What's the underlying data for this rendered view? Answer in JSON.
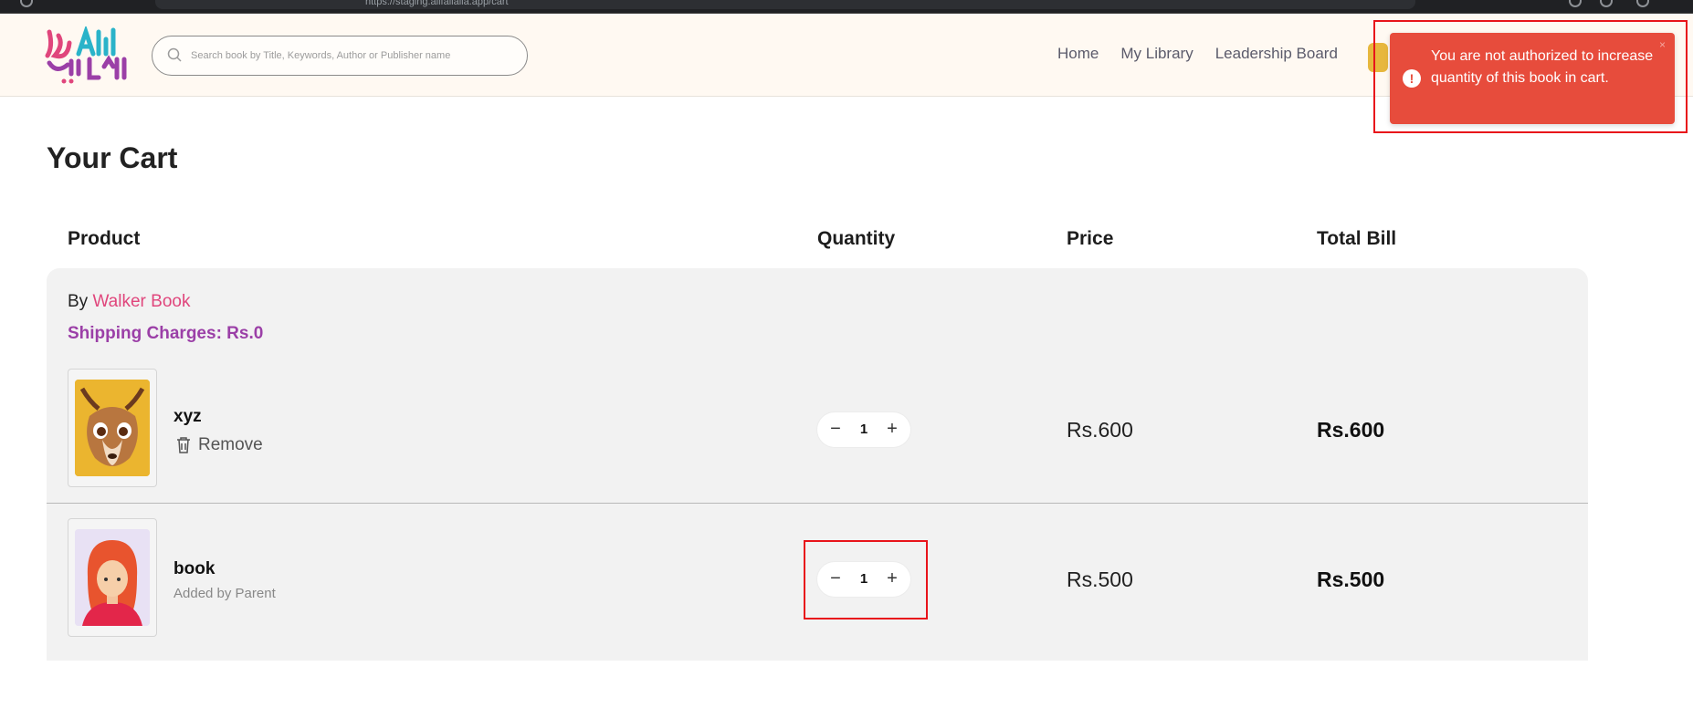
{
  "browser": {
    "url": "https://staging.alifailaila.app/cart"
  },
  "header": {
    "logo_text": "Alif Laila",
    "search_placeholder": "Search book by Title, Keywords, Author or Publisher name",
    "nav": [
      "Home",
      "My Library",
      "Leadership Board"
    ]
  },
  "toast": {
    "message": "You are not authorized to increase quantity of this book in cart.",
    "close_label": "×",
    "icon": "error-icon",
    "color": "#e74c3c"
  },
  "cart": {
    "title": "Your Cart",
    "columns": {
      "product": "Product",
      "quantity": "Quantity",
      "price": "Price",
      "total": "Total Bill"
    },
    "seller_prefix": "By ",
    "seller_name": "Walker Book",
    "shipping": "Shipping Charges: Rs.0",
    "items": [
      {
        "name": "xyz",
        "action_label": "Remove",
        "quantity": "1",
        "minus": "−",
        "plus": "+",
        "price": "Rs.600",
        "total": "Rs.600",
        "cover_icon": "deer-cover-icon"
      },
      {
        "name": "book",
        "note": "Added by Parent",
        "quantity": "1",
        "minus": "−",
        "plus": "+",
        "price": "Rs.500",
        "total": "Rs.500",
        "cover_icon": "girl-avatar-cover-icon"
      }
    ]
  },
  "colors": {
    "seller": "#e0467c",
    "shipping": "#9b3fa7",
    "highlight": "#e8141b"
  }
}
